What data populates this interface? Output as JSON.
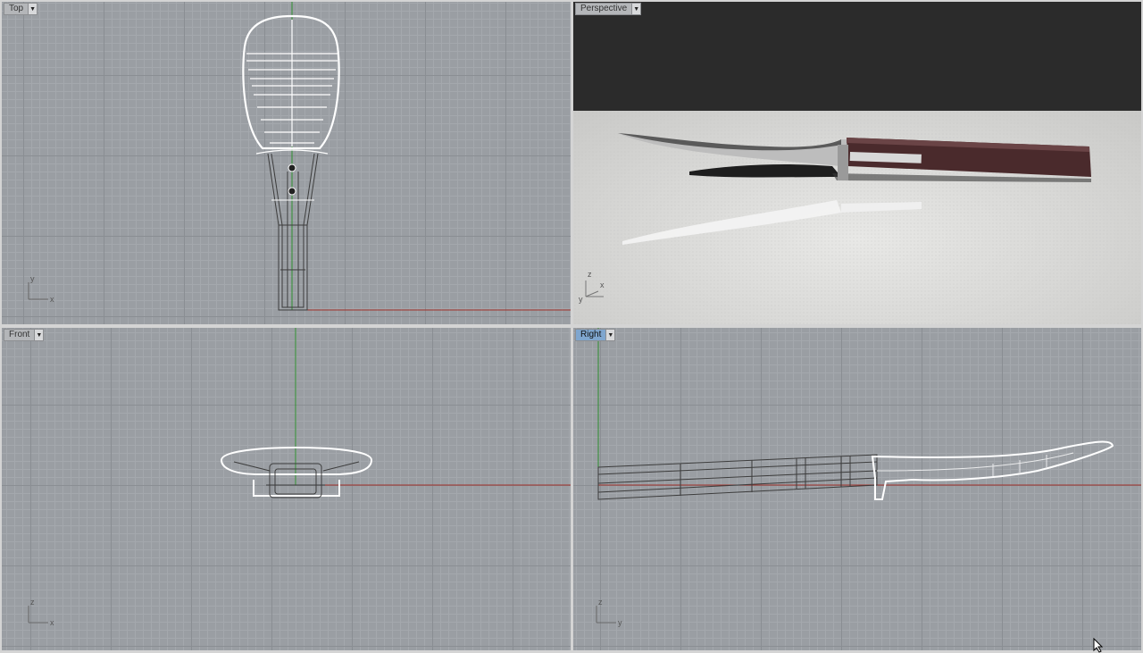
{
  "viewports": {
    "top": {
      "label": "Top"
    },
    "persp": {
      "label": "Perspective"
    },
    "front": {
      "label": "Front"
    },
    "right": {
      "label": "Right"
    }
  },
  "axes": {
    "top": {
      "a": "y",
      "b": "x"
    },
    "persp": {
      "a": "z",
      "b": "y",
      "c": "x"
    },
    "front": {
      "a": "z",
      "b": "x"
    },
    "right": {
      "a": "z",
      "b": "y"
    }
  },
  "colors": {
    "grid_bg": "#9a9ea3",
    "x_axis": "#a0302a",
    "y_axis": "#2f8f2f",
    "wireframe_selected": "#ffffff",
    "wireframe_dark": "#3c3c3c",
    "active_tab": "#7fa6cf",
    "handle": "#4a2a2c",
    "blade": "#c8c8c8"
  },
  "icons": {
    "dropdown": "chevron-down-icon",
    "cursor": "mouse-pointer-icon"
  }
}
